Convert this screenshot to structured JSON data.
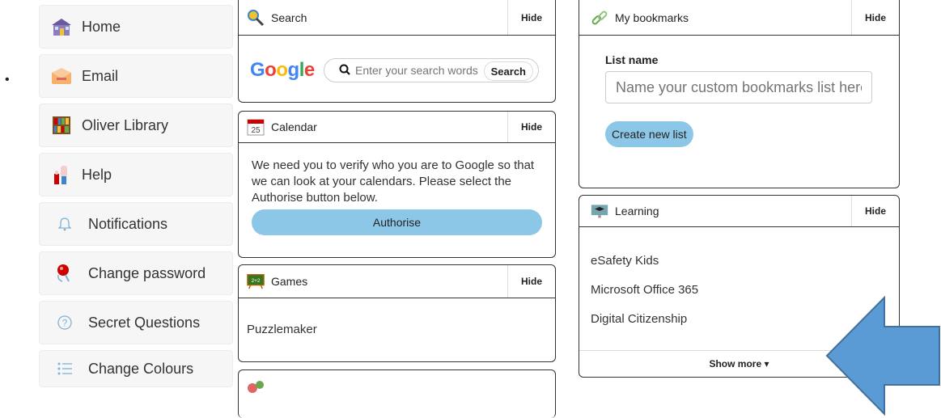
{
  "sidebar": {
    "items": [
      {
        "label": "Home",
        "icon": "home-icon"
      },
      {
        "label": "Email",
        "icon": "email-icon"
      },
      {
        "label": "Oliver Library",
        "icon": "library-icon"
      },
      {
        "label": "Help",
        "icon": "help-icon"
      },
      {
        "label": "Notifications",
        "icon": "bell-icon"
      },
      {
        "label": "Change password",
        "icon": "key-icon"
      },
      {
        "label": "Secret Questions",
        "icon": "question-icon"
      },
      {
        "label": "Change Colours",
        "icon": "list-icon"
      }
    ]
  },
  "panels": {
    "hide_label": "Hide",
    "search": {
      "title": "Search",
      "logo": "Google",
      "placeholder": "Enter your search words",
      "button": "Search"
    },
    "calendar": {
      "title": "Calendar",
      "icon_day": "25",
      "message": "We need you to verify who you are to Google so that we can look at your calendars. Please select the Authorise button below.",
      "button": "Authorise"
    },
    "games": {
      "title": "Games",
      "icon_text": "2+2",
      "links": [
        "Puzzlemaker"
      ]
    },
    "bookmarks": {
      "title": "My bookmarks",
      "list_label": "List name",
      "list_placeholder": "Name your custom bookmarks list here",
      "create_button": "Create new list"
    },
    "learning": {
      "title": "Learning",
      "links": [
        "eSafety Kids",
        "Microsoft Office 365",
        "Digital Citizenship"
      ],
      "show_more": "Show more ▾"
    }
  },
  "colors": {
    "button_blue": "#8dc7e8",
    "arrow_blue": "#5b9bd5",
    "sidebar_bg": "#f6f6f6"
  }
}
